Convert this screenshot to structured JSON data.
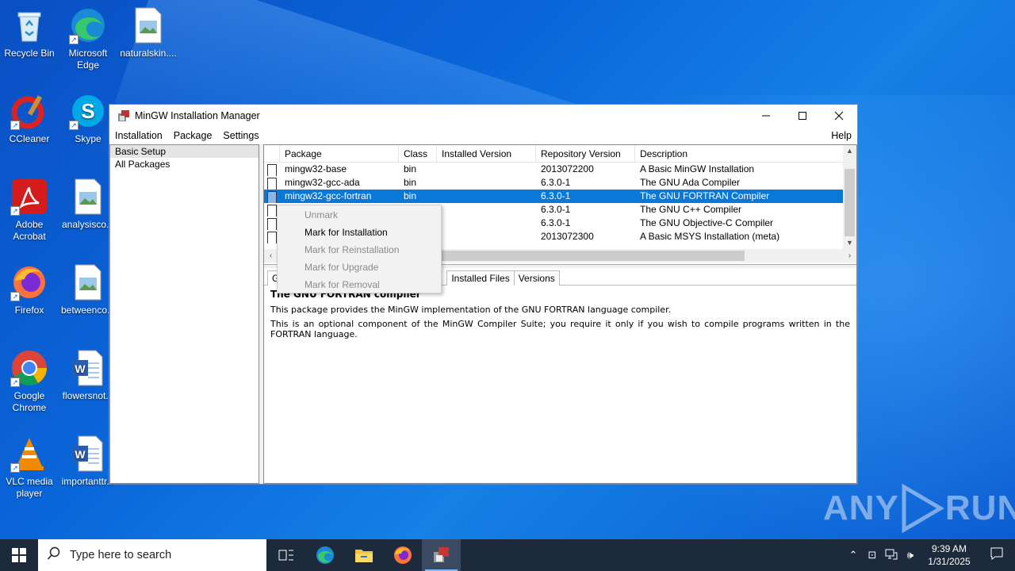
{
  "desktop": {
    "icons": [
      {
        "label": "Recycle Bin"
      },
      {
        "label": "Microsoft Edge"
      },
      {
        "label": "naturalskin...."
      },
      {
        "label": "CCleaner"
      },
      {
        "label": "Skype"
      },
      {
        "label": "Adobe Acrobat"
      },
      {
        "label": "analysisco..."
      },
      {
        "label": "Firefox"
      },
      {
        "label": "betweenco..."
      },
      {
        "label": "Google Chrome"
      },
      {
        "label": "flowersnot..."
      },
      {
        "label": "VLC media player"
      },
      {
        "label": "importanttr..."
      }
    ]
  },
  "window": {
    "title": "MinGW Installation Manager",
    "menu": {
      "installation": "Installation",
      "package": "Package",
      "settings": "Settings",
      "help": "Help"
    },
    "left_pane": {
      "items": [
        "Basic Setup",
        "All Packages"
      ],
      "selected": "Basic Setup"
    },
    "table": {
      "columns": [
        "Package",
        "Class",
        "Installed Version",
        "Repository Version",
        "Description"
      ],
      "rows": [
        {
          "package": "mingw32-base",
          "class": "bin",
          "installed": "",
          "repo": "2013072200",
          "desc": "A Basic MinGW Installation"
        },
        {
          "package": "mingw32-gcc-ada",
          "class": "bin",
          "installed": "",
          "repo": "6.3.0-1",
          "desc": "The GNU Ada Compiler"
        },
        {
          "package": "mingw32-gcc-fortran",
          "class": "bin",
          "installed": "",
          "repo": "6.3.0-1",
          "desc": "The GNU FORTRAN Compiler"
        },
        {
          "package": "",
          "class": "",
          "installed": "",
          "repo": "6.3.0-1",
          "desc": "The GNU C++ Compiler"
        },
        {
          "package": "",
          "class": "",
          "installed": "",
          "repo": "6.3.0-1",
          "desc": "The GNU Objective-C Compiler"
        },
        {
          "package": "",
          "class": "",
          "installed": "",
          "repo": "2013072300",
          "desc": "A Basic MSYS Installation (meta)"
        }
      ],
      "selected_row": 2
    },
    "tabs": {
      "first": "G",
      "installed_files": "Installed Files",
      "versions": "Versions"
    },
    "details": {
      "heading": "The GNU FORTRAN compiler",
      "p1": "This package provides the MinGW implementation of the GNU FORTRAN language compiler.",
      "p2": "This is an optional component of the MinGW Compiler Suite; you require it only if you wish to compile programs written in the FORTRAN language."
    },
    "context_menu": {
      "items": [
        {
          "label": "Unmark",
          "enabled": false
        },
        {
          "label": "Mark for Installation",
          "enabled": true
        },
        {
          "label": "Mark for Reinstallation",
          "enabled": false
        },
        {
          "label": "Mark for Upgrade",
          "enabled": false
        },
        {
          "label": "Mark for Removal",
          "enabled": false
        }
      ]
    }
  },
  "taskbar": {
    "search_placeholder": "Type here to search",
    "clock_time": "9:39 AM",
    "clock_date": "1/31/2025"
  },
  "watermark": {
    "text_left": "ANY",
    "text_right": "RUN"
  },
  "colors": {
    "selection": "#0a78d7",
    "taskbar": "#1c2a3b",
    "desktop": "#0a66d9"
  }
}
